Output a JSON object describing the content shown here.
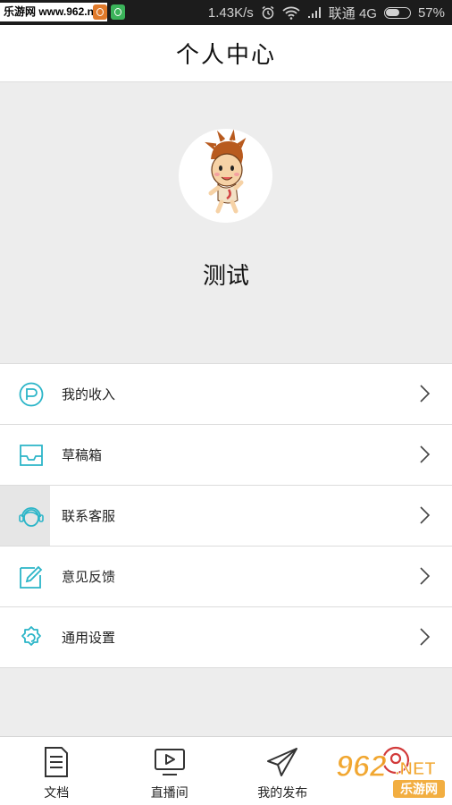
{
  "status_bar": {
    "watermark": "乐游网 www.962.net",
    "network_speed": "1.43K/s",
    "carrier": "联通 4G",
    "battery": "57%",
    "battery_level": 0.57
  },
  "header": {
    "title": "个人中心"
  },
  "profile": {
    "username": "测试"
  },
  "menu": {
    "items": [
      {
        "label": "我的收入",
        "icon": "income-icon"
      },
      {
        "label": "草稿箱",
        "icon": "drafts-inbox-icon"
      },
      {
        "label": "联系客服",
        "icon": "customer-service-icon"
      },
      {
        "label": "意见反馈",
        "icon": "feedback-edit-icon"
      },
      {
        "label": "通用设置",
        "icon": "settings-gear-icon"
      }
    ]
  },
  "bottom_nav": {
    "items": [
      {
        "label": "文档",
        "icon": "document-icon"
      },
      {
        "label": "直播间",
        "icon": "live-tv-icon"
      },
      {
        "label": "我的发布",
        "icon": "paper-plane-icon"
      },
      {
        "label": "",
        "icon": "profile-icon"
      }
    ]
  },
  "watermark_logo": {
    "text1": "962",
    "text2": ".NET",
    "text3": "乐游网"
  },
  "colors": {
    "accent": "#2bb5c8",
    "background": "#ededed"
  }
}
